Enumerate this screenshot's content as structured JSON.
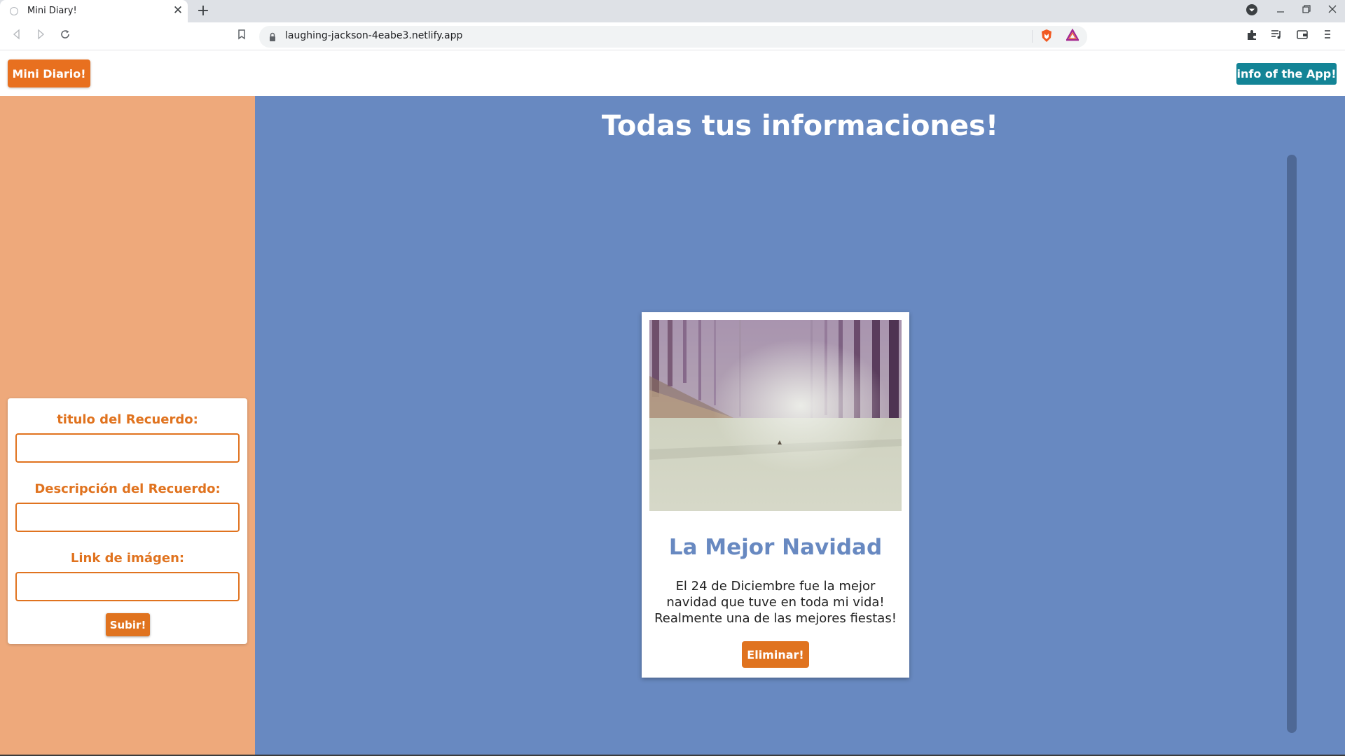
{
  "browser": {
    "tab_title": "Mini Diary!",
    "tab_close": "✕",
    "new_tab": "+",
    "url": "laughing-jackson-4eabe3.netlify.app",
    "icons": [
      "back-icon",
      "forward-icon",
      "reload-icon",
      "bookmark-icon",
      "lock-icon",
      "brave-shield-icon",
      "brave-rewards-icon",
      "extensions-icon",
      "media-queue-icon",
      "wallet-icon",
      "menu-icon",
      "profile-dropdown-icon",
      "minimize-icon",
      "maximize-icon",
      "close-window-icon"
    ]
  },
  "navbar": {
    "brand": "Mini Diario!",
    "info_button": "info of the App!"
  },
  "form": {
    "title_label": "titulo del Recuerdo:",
    "title_value": "",
    "description_label": "Descripción del Recuerdo:",
    "description_value": "",
    "image_label": "Link de imágen:",
    "image_value": "",
    "submit_label": "Subir!"
  },
  "main": {
    "heading": "Todas tus informaciones!"
  },
  "memories": [
    {
      "title": "La Mejor Navidad",
      "description": "El 24 de Diciembre fue la mejor navidad que tuve en toda mi vida! Realmente una de las mejores fiestas!",
      "delete_label": "Eliminar!"
    }
  ],
  "colors": {
    "accent_orange": "#e0731f",
    "sidebar_bg": "#eea97b",
    "main_bg": "#6889c1",
    "info_teal": "#138496"
  }
}
